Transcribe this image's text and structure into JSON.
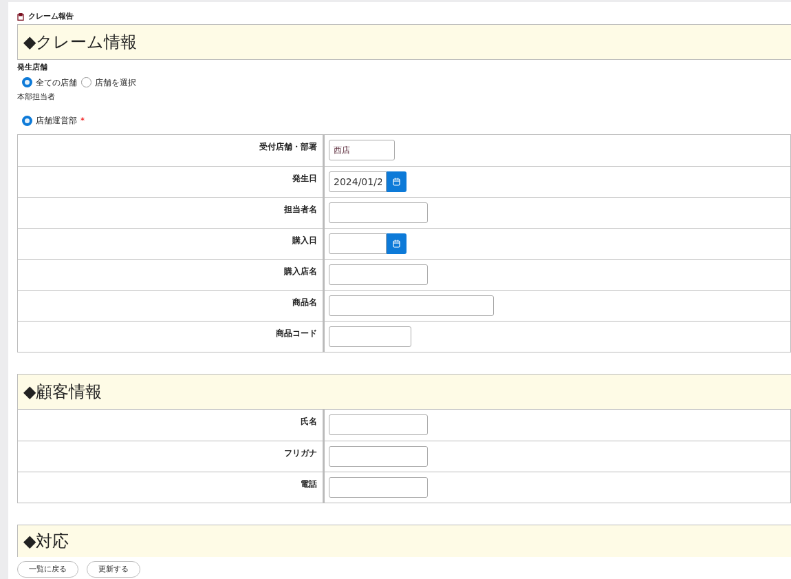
{
  "page_title": "クレーム報告",
  "sections": [
    {
      "heading": "◆クレーム情報",
      "groups": [
        {
          "label": "発生店舗",
          "options": [
            {
              "label": "全ての店舗",
              "selected": true
            },
            {
              "label": "店舗を選択",
              "selected": false
            }
          ]
        },
        {
          "label": "本部担当者",
          "options": [
            {
              "label": "店舗運営部",
              "selected": true
            }
          ],
          "required_mark": "*"
        }
      ],
      "rows": [
        {
          "label": "受付店舗・部署",
          "kind": "text",
          "value": "西店"
        },
        {
          "label": "発生日",
          "kind": "date",
          "value": "2024/01/2"
        },
        {
          "label": "担当者名",
          "kind": "text",
          "value": ""
        },
        {
          "label": "購入日",
          "kind": "date",
          "value": ""
        },
        {
          "label": "購入店名",
          "kind": "text",
          "value": ""
        },
        {
          "label": "商品名",
          "kind": "text",
          "value": ""
        },
        {
          "label": "商品コード",
          "kind": "text",
          "value": ""
        }
      ]
    },
    {
      "heading": "◆顧客情報",
      "rows": [
        {
          "label": "氏名",
          "kind": "text",
          "value": ""
        },
        {
          "label": "フリガナ",
          "kind": "text",
          "value": ""
        },
        {
          "label": "電話",
          "kind": "text",
          "value": ""
        }
      ]
    },
    {
      "heading": "◆対応"
    }
  ],
  "buttons": [
    "一覧に戻る",
    "更新する"
  ]
}
